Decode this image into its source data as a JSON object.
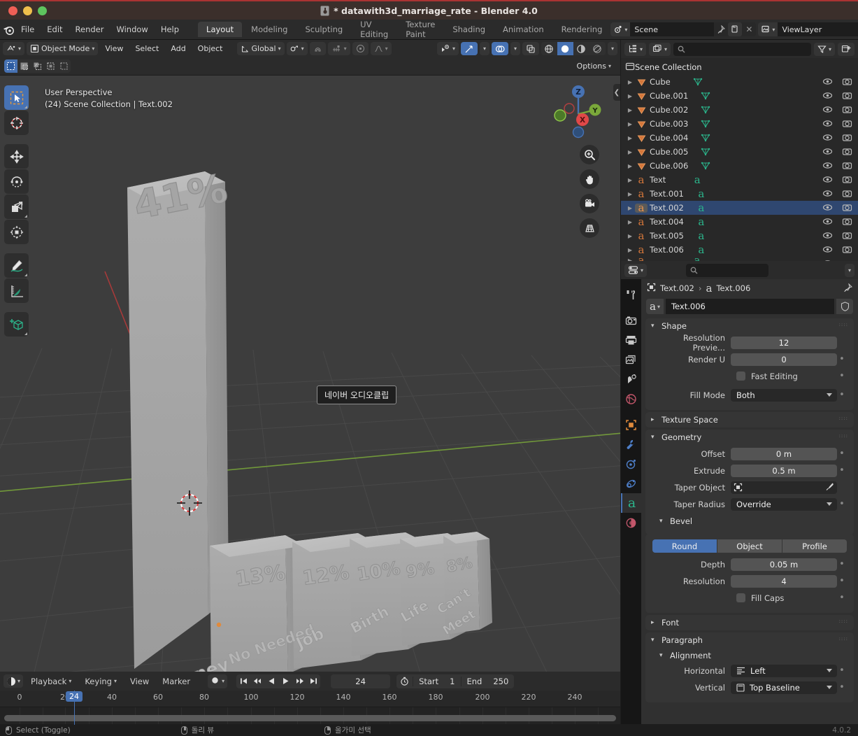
{
  "window": {
    "title": "* datawith3d_marriage_rate - Blender 4.0",
    "version": "4.0.2"
  },
  "menubar": {
    "items": [
      "File",
      "Edit",
      "Render",
      "Window",
      "Help"
    ],
    "workspaces": [
      {
        "label": "Layout",
        "active": true
      },
      {
        "label": "Modeling",
        "active": false
      },
      {
        "label": "Sculpting",
        "active": false
      },
      {
        "label": "UV Editing",
        "active": false
      },
      {
        "label": "Texture Paint",
        "active": false
      },
      {
        "label": "Shading",
        "active": false
      },
      {
        "label": "Animation",
        "active": false
      },
      {
        "label": "Rendering",
        "active": false
      }
    ],
    "scene_name": "Scene",
    "viewlayer_name": "ViewLayer"
  },
  "viewport": {
    "mode": "Object Mode",
    "menus": [
      "View",
      "Select",
      "Add",
      "Object"
    ],
    "transform_orientation": "Global",
    "options_label": "Options",
    "overlay_line1": "User Perspective",
    "overlay_line2": "(24) Scene Collection | Text.002",
    "scene_text_label": "네이버 오디오클립",
    "gizmo_axes": {
      "x": "X",
      "y": "Y",
      "z": "Z"
    }
  },
  "chart_data": {
    "type": "bar",
    "title": "datawith3d_marriage_rate",
    "categories": [
      "Money",
      "No Needed",
      "Job",
      "Birth",
      "Life",
      "Can't Meet"
    ],
    "values": [
      41,
      13,
      12,
      10,
      9,
      8
    ],
    "value_labels": [
      "41%",
      "13%",
      "12%",
      "10%",
      "9%",
      "8%"
    ],
    "ylabel": "",
    "xlabel": "",
    "ylim": [
      0,
      45
    ]
  },
  "outliner": {
    "root": "Scene Collection",
    "items": [
      {
        "name": "Cube",
        "type": "mesh",
        "selected": false
      },
      {
        "name": "Cube.001",
        "type": "mesh",
        "selected": false
      },
      {
        "name": "Cube.002",
        "type": "mesh",
        "selected": false
      },
      {
        "name": "Cube.003",
        "type": "mesh",
        "selected": false
      },
      {
        "name": "Cube.004",
        "type": "mesh",
        "selected": false
      },
      {
        "name": "Cube.005",
        "type": "mesh",
        "selected": false
      },
      {
        "name": "Cube.006",
        "type": "mesh",
        "selected": false
      },
      {
        "name": "Text",
        "type": "font",
        "selected": false
      },
      {
        "name": "Text.001",
        "type": "font",
        "selected": false
      },
      {
        "name": "Text.002",
        "type": "font",
        "selected": true
      },
      {
        "name": "Text.004",
        "type": "font",
        "selected": false
      },
      {
        "name": "Text.005",
        "type": "font",
        "selected": false
      },
      {
        "name": "Text.006",
        "type": "font",
        "selected": false
      }
    ]
  },
  "properties": {
    "breadcrumb_object": "Text.002",
    "breadcrumb_data": "Text.006",
    "id_name": "Text.006",
    "shape": {
      "title": "Shape",
      "resolution_preview_label": "Resolution Previe...",
      "resolution_preview_value": "12",
      "render_u_label": "Render U",
      "render_u_value": "0",
      "fast_editing_label": "Fast Editing",
      "fill_mode_label": "Fill Mode",
      "fill_mode_value": "Both"
    },
    "texture_space_title": "Texture Space",
    "geometry": {
      "title": "Geometry",
      "offset_label": "Offset",
      "offset_value": "0 m",
      "extrude_label": "Extrude",
      "extrude_value": "0.5 m",
      "taper_object_label": "Taper Object",
      "taper_object_value": "",
      "taper_radius_label": "Taper Radius",
      "taper_radius_value": "Override",
      "bevel_title": "Bevel",
      "bevel_types": [
        "Round",
        "Object",
        "Profile"
      ],
      "bevel_active": "Round",
      "depth_label": "Depth",
      "depth_value": "0.05 m",
      "resolution_label": "Resolution",
      "resolution_value": "4",
      "fill_caps_label": "Fill Caps"
    },
    "font_title": "Font",
    "paragraph": {
      "title": "Paragraph",
      "alignment_title": "Alignment",
      "horizontal_label": "Horizontal",
      "horizontal_value": "Left",
      "vertical_label": "Vertical",
      "vertical_value": "Top Baseline"
    }
  },
  "timeline": {
    "menus": [
      "Playback",
      "Keying",
      "View",
      "Marker"
    ],
    "current_frame": "24",
    "start_label": "Start",
    "start_value": "1",
    "end_label": "End",
    "end_value": "250",
    "ticks": [
      "0",
      "20",
      "40",
      "60",
      "80",
      "100",
      "120",
      "140",
      "160",
      "180",
      "200",
      "220",
      "240"
    ]
  },
  "statusbar": {
    "items": [
      "Select (Toggle)",
      "돌리 뷰",
      "올가미 선택"
    ],
    "version": "4.0.2"
  },
  "colors": {
    "accent_blue": "#4772b3",
    "mesh_orange": "#e08a3c",
    "data_green": "#2bb38a",
    "axis_x": "#e04848",
    "axis_y": "#8fc44a",
    "axis_z": "#4772b3"
  }
}
